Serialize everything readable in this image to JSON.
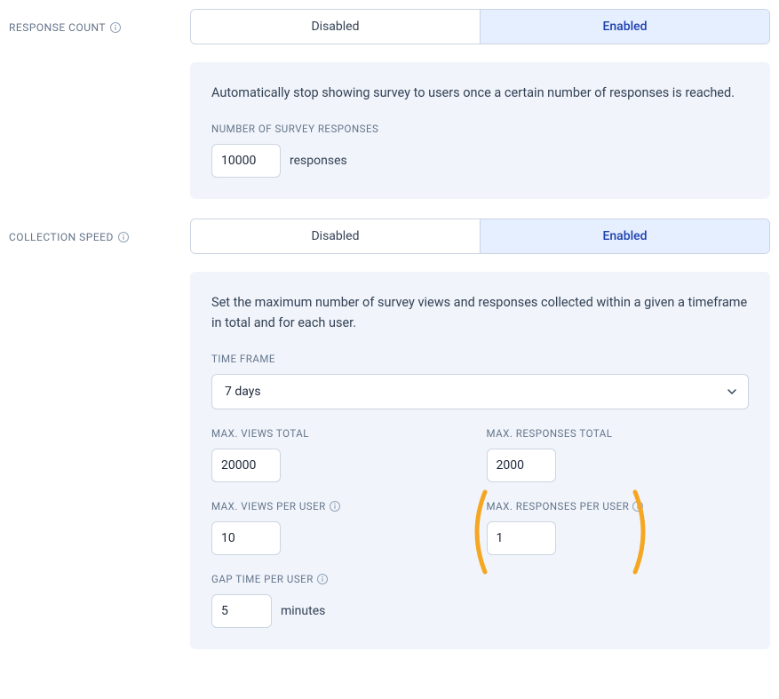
{
  "responseCount": {
    "label": "RESPONSE COUNT",
    "toggle": {
      "disabled": "Disabled",
      "enabled": "Enabled"
    },
    "description": "Automatically stop showing survey to users once a certain number of responses is reached.",
    "field": {
      "label": "NUMBER OF SURVEY RESPONSES",
      "value": "10000",
      "suffix": "responses"
    }
  },
  "collectionSpeed": {
    "label": "COLLECTION SPEED",
    "toggle": {
      "disabled": "Disabled",
      "enabled": "Enabled"
    },
    "description": "Set the maximum number of survey views and responses collected within a given a timeframe in total and for each user.",
    "timeFrame": {
      "label": "TIME FRAME",
      "value": "7 days"
    },
    "maxViewsTotal": {
      "label": "MAX. VIEWS TOTAL",
      "value": "20000"
    },
    "maxResponsesTotal": {
      "label": "MAX. RESPONSES TOTAL",
      "value": "2000"
    },
    "maxViewsPerUser": {
      "label": "MAX. VIEWS PER USER",
      "value": "10"
    },
    "maxResponsesPerUser": {
      "label": "MAX. RESPONSES PER USER",
      "value": "1"
    },
    "gapTimePerUser": {
      "label": "GAP TIME PER USER",
      "value": "5",
      "suffix": "minutes"
    }
  }
}
